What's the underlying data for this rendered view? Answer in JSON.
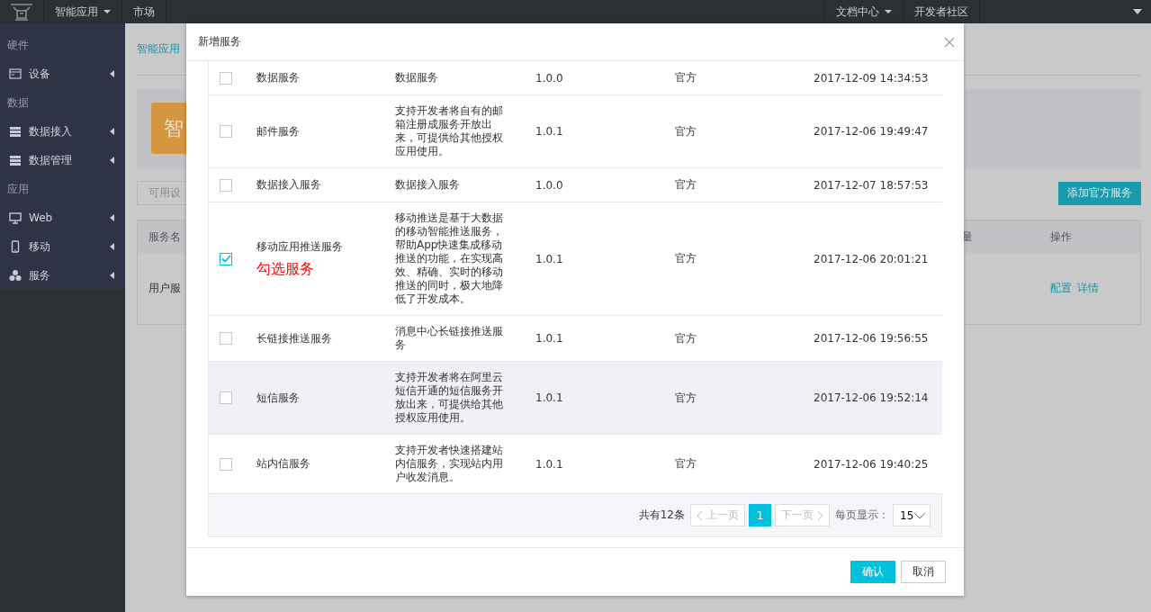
{
  "topbar": {
    "menus": [
      {
        "label": "智能应用",
        "dropdown": true
      },
      {
        "label": "市场",
        "dropdown": false
      }
    ],
    "right_menus": [
      {
        "label": "文档中心",
        "dropdown": true
      },
      {
        "label": "开发者社区",
        "dropdown": false
      }
    ]
  },
  "sidebar": [
    {
      "section": "硬件",
      "items": [
        {
          "label": "设备",
          "kind": "window"
        }
      ]
    },
    {
      "section": "数据",
      "items": [
        {
          "label": "数据接入",
          "kind": "server"
        },
        {
          "label": "数据管理",
          "kind": "server"
        }
      ]
    },
    {
      "section": "应用",
      "items": [
        {
          "label": "Web",
          "kind": "monitor"
        },
        {
          "label": "移动",
          "kind": "phone"
        },
        {
          "label": "服务",
          "kind": "cluster"
        }
      ]
    }
  ],
  "page": {
    "breadcrumb": "智能应用",
    "banner_initial": "智",
    "filter_placeholder": "可用设",
    "add_button": "添加官方服务",
    "table": {
      "columns": [
        "服务名",
        "量",
        "操作"
      ],
      "rows": [
        {
          "name": "用户服",
          "actions": [
            "配置",
            "详情"
          ]
        }
      ]
    }
  },
  "dialog": {
    "title": "新增服务",
    "rows": [
      {
        "checked": false,
        "highlighted": false,
        "name": "数据服务",
        "description": "数据服务",
        "version": "1.0.0",
        "source": "官方",
        "time": "2017-12-09 14:34:53"
      },
      {
        "checked": false,
        "highlighted": false,
        "name": "邮件服务",
        "description": "支持开发者将自有的邮箱注册成服务开放出来，可提供给其他授权应用使用。",
        "version": "1.0.1",
        "source": "官方",
        "time": "2017-12-06 19:49:47"
      },
      {
        "checked": false,
        "highlighted": false,
        "name": "数据接入服务",
        "description": "数据接入服务",
        "version": "1.0.0",
        "source": "官方",
        "time": "2017-12-07 18:57:53"
      },
      {
        "checked": true,
        "highlighted": false,
        "name": "移动应用推送服务",
        "annotation": "勾选服务",
        "description": "移动推送是基于大数据的移动智能推送服务，帮助App快速集成移动推送的功能，在实现高效、精确、实时的移动推送的同时，极大地降低了开发成本。",
        "version": "1.0.1",
        "source": "官方",
        "time": "2017-12-06 20:01:21"
      },
      {
        "checked": false,
        "highlighted": false,
        "name": "长链接推送服务",
        "description": "消息中心长链接推送服务",
        "version": "1.0.1",
        "source": "官方",
        "time": "2017-12-06 19:56:55"
      },
      {
        "checked": false,
        "highlighted": true,
        "name": "短信服务",
        "description": "支持开发者将在阿里云短信开通的短信服务开放出来，可提供给其他授权应用使用。",
        "version": "1.0.1",
        "source": "官方",
        "time": "2017-12-06 19:52:14"
      },
      {
        "checked": false,
        "highlighted": false,
        "name": "站内信服务",
        "description": "支持开发者快速搭建站内信服务，实现站内用户收发消息。",
        "version": "1.0.1",
        "source": "官方",
        "time": "2017-12-06 19:40:25"
      }
    ],
    "pagination": {
      "total": "共有12条",
      "prev": {
        "label": "上一页",
        "disabled": true
      },
      "pages": [
        {
          "label": "1",
          "selected": true
        }
      ],
      "next": {
        "label": "下一页",
        "disabled": true
      },
      "page_size_label": "每页显示：",
      "page_size": "15"
    },
    "buttons": [
      {
        "label": "确认",
        "kind": "primary"
      },
      {
        "label": "取消",
        "kind": "default"
      }
    ]
  }
}
